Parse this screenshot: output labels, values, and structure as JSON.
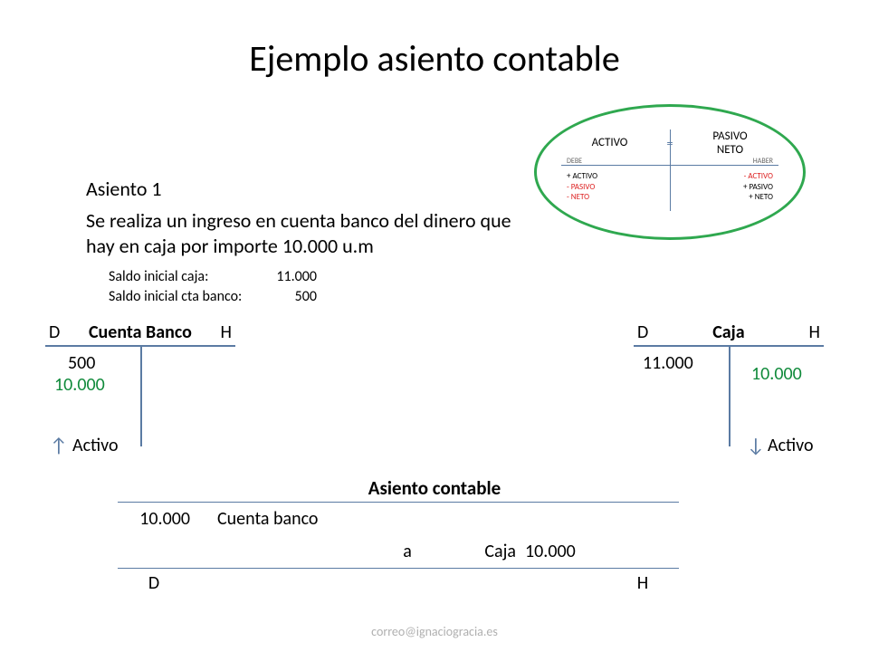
{
  "title": "Ejemplo asiento contable",
  "asiento_label": "Asiento 1",
  "description": "Se realiza un ingreso en cuenta banco del dinero que hay en caja por importe 10.000 u.m",
  "initial": {
    "caja_label": "Saldo inicial caja:",
    "caja_value": "11.000",
    "banco_label": "Saldo inicial cta banco:",
    "banco_value": "500"
  },
  "t_banco": {
    "d": "D",
    "name": "Cuenta Banco",
    "h": "H",
    "debit_1": "500",
    "debit_2": "10.000",
    "activo": "Activo"
  },
  "t_caja": {
    "d": "D",
    "name": "Caja",
    "h": "H",
    "debit_1": "11.000",
    "credit_1": "10.000",
    "activo": "Activo"
  },
  "asiento": {
    "title": "Asiento contable",
    "amount_d": "10.000",
    "account_d": "Cuenta banco",
    "a": "a",
    "account_h": "Caja",
    "amount_h": "10.000",
    "d": "D",
    "h": "H"
  },
  "info": {
    "activo": "ACTIVO",
    "eq": "=",
    "pasivo_neto_1": "PASIVO",
    "pasivo_neto_2": "NETO",
    "debe": "DEBE",
    "haber": "HABER",
    "left_1": "+ ACTIVO",
    "left_2": "- PASIVO",
    "left_3": "- NETO",
    "right_1": "- ACTIVO",
    "right_2": "+ PASIVO",
    "right_3": "+ NETO"
  },
  "footer": "correo@ignaciogracia.es"
}
